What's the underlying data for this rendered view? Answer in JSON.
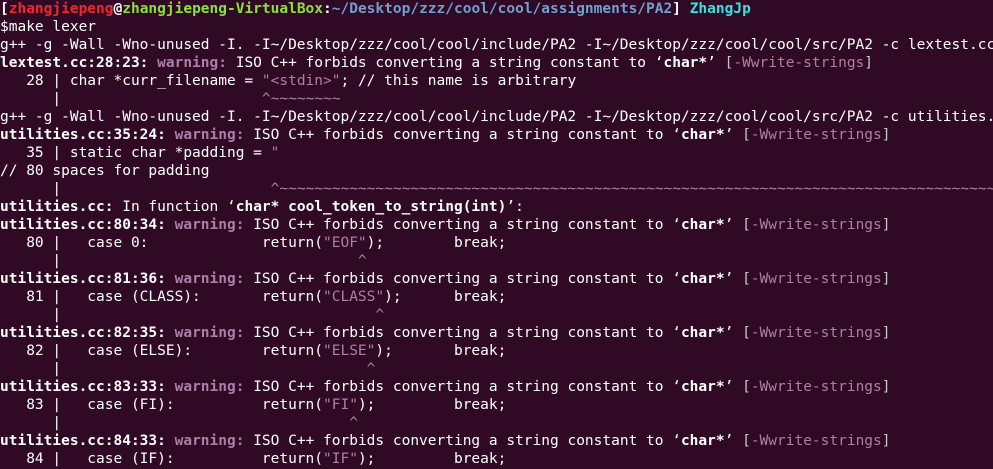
{
  "prompt": {
    "bracket_open": "[",
    "user": "zhangjiepeng",
    "at": "@",
    "host": "zhangjiepeng-VirtualBox",
    "colon": ":",
    "path": "~/Desktop/zzz/cool/cool/assignments/PA2",
    "bracket_close": "]",
    "name": "ZhangJp"
  },
  "lines": [
    {
      "segs": [
        {
          "t": "$make lexer"
        }
      ]
    },
    {
      "segs": [
        {
          "t": "g++ -g -Wall -Wno-unused -I. -I~/Desktop/zzz/cool/cool/include/PA2 -I~/Desktop/zzz/cool/cool/src/PA2 -c lextest.cc"
        }
      ]
    },
    {
      "segs": [
        {
          "t": "lextest.cc:28:23: ",
          "c": "bold"
        },
        {
          "t": "warning: ",
          "c": "bold warn"
        },
        {
          "t": "ISO C++ forbids converting a string constant to "
        },
        {
          "t": "‘"
        },
        {
          "t": "char*",
          "c": "bold"
        },
        {
          "t": "’ "
        },
        {
          "t": "[",
          "c": "gray"
        },
        {
          "t": "-Wwrite-strings",
          "c": "warn"
        },
        {
          "t": "]",
          "c": "gray"
        }
      ]
    },
    {
      "segs": [
        {
          "t": "   28 | char *curr_filename = "
        },
        {
          "t": "\"<stdin>\"",
          "c": "warn"
        },
        {
          "t": "; // this name is arbitrary"
        }
      ]
    },
    {
      "segs": [
        {
          "t": "      |                       "
        },
        {
          "t": "^~~~~~~~~",
          "c": "warn"
        }
      ]
    },
    {
      "segs": [
        {
          "t": "g++ -g -Wall -Wno-unused -I. -I~/Desktop/zzz/cool/cool/include/PA2 -I~/Desktop/zzz/cool/cool/src/PA2 -c utilities.cc"
        }
      ]
    },
    {
      "segs": [
        {
          "t": "utilities.cc:35:24: ",
          "c": "bold"
        },
        {
          "t": "warning: ",
          "c": "bold warn"
        },
        {
          "t": "ISO C++ forbids converting a string constant to "
        },
        {
          "t": "‘"
        },
        {
          "t": "char*",
          "c": "bold"
        },
        {
          "t": "’ "
        },
        {
          "t": "[",
          "c": "gray"
        },
        {
          "t": "-Wwrite-strings",
          "c": "warn"
        },
        {
          "t": "]",
          "c": "gray"
        }
      ]
    },
    {
      "segs": [
        {
          "t": "   35 | static char *padding = "
        },
        {
          "t": "\"",
          "c": "warn"
        }
      ]
    },
    {
      "segs": [
        {
          "t": "// 80 spaces for padding"
        }
      ]
    },
    {
      "segs": [
        {
          "t": "      |                        "
        },
        {
          "t": "^~~~~~~~~~~~~~~~~~~~~~~~~~~~~~~~~~~~~~~~~~~~~~~~~~~~~~~~~~~~~~~~~~~~~~~~~~~~~~~~~~~~~~~~~~~~~~~~",
          "c": "warn"
        }
      ]
    },
    {
      "segs": [
        {
          "t": "utilities.cc:",
          "c": "bold"
        },
        {
          "t": " In function "
        },
        {
          "t": "‘"
        },
        {
          "t": "char* cool_token_to_string(int)",
          "c": "bold"
        },
        {
          "t": "’:"
        }
      ]
    },
    {
      "segs": [
        {
          "t": "utilities.cc:80:34: ",
          "c": "bold"
        },
        {
          "t": "warning: ",
          "c": "bold warn"
        },
        {
          "t": "ISO C++ forbids converting a string constant to "
        },
        {
          "t": "‘"
        },
        {
          "t": "char*",
          "c": "bold"
        },
        {
          "t": "’ "
        },
        {
          "t": "[",
          "c": "gray"
        },
        {
          "t": "-Wwrite-strings",
          "c": "warn"
        },
        {
          "t": "]",
          "c": "gray"
        }
      ]
    },
    {
      "segs": [
        {
          "t": "   80 |   case 0:             return("
        },
        {
          "t": "\"EOF\"",
          "c": "warn"
        },
        {
          "t": ");        break;"
        }
      ]
    },
    {
      "segs": [
        {
          "t": "      |                                  "
        },
        {
          "t": "^",
          "c": "warn"
        }
      ]
    },
    {
      "segs": [
        {
          "t": "utilities.cc:81:36: ",
          "c": "bold"
        },
        {
          "t": "warning: ",
          "c": "bold warn"
        },
        {
          "t": "ISO C++ forbids converting a string constant to "
        },
        {
          "t": "‘"
        },
        {
          "t": "char*",
          "c": "bold"
        },
        {
          "t": "’ "
        },
        {
          "t": "[",
          "c": "gray"
        },
        {
          "t": "-Wwrite-strings",
          "c": "warn"
        },
        {
          "t": "]",
          "c": "gray"
        }
      ]
    },
    {
      "segs": [
        {
          "t": "   81 |   case (CLASS):       return("
        },
        {
          "t": "\"CLASS\"",
          "c": "warn"
        },
        {
          "t": ");      break;"
        }
      ]
    },
    {
      "segs": [
        {
          "t": "      |                                    "
        },
        {
          "t": "^",
          "c": "warn"
        }
      ]
    },
    {
      "segs": [
        {
          "t": "utilities.cc:82:35: ",
          "c": "bold"
        },
        {
          "t": "warning: ",
          "c": "bold warn"
        },
        {
          "t": "ISO C++ forbids converting a string constant to "
        },
        {
          "t": "‘"
        },
        {
          "t": "char*",
          "c": "bold"
        },
        {
          "t": "’ "
        },
        {
          "t": "[",
          "c": "gray"
        },
        {
          "t": "-Wwrite-strings",
          "c": "warn"
        },
        {
          "t": "]",
          "c": "gray"
        }
      ]
    },
    {
      "segs": [
        {
          "t": "   82 |   case (ELSE):        return("
        },
        {
          "t": "\"ELSE\"",
          "c": "warn"
        },
        {
          "t": ");       break;"
        }
      ]
    },
    {
      "segs": [
        {
          "t": "      |                                   "
        },
        {
          "t": "^",
          "c": "warn"
        }
      ]
    },
    {
      "segs": [
        {
          "t": "utilities.cc:83:33: ",
          "c": "bold"
        },
        {
          "t": "warning: ",
          "c": "bold warn"
        },
        {
          "t": "ISO C++ forbids converting a string constant to "
        },
        {
          "t": "‘"
        },
        {
          "t": "char*",
          "c": "bold"
        },
        {
          "t": "’ "
        },
        {
          "t": "[",
          "c": "gray"
        },
        {
          "t": "-Wwrite-strings",
          "c": "warn"
        },
        {
          "t": "]",
          "c": "gray"
        }
      ]
    },
    {
      "segs": [
        {
          "t": "   83 |   case (FI):          return("
        },
        {
          "t": "\"FI\"",
          "c": "warn"
        },
        {
          "t": ");         break;"
        }
      ]
    },
    {
      "segs": [
        {
          "t": "      |                                 "
        },
        {
          "t": "^",
          "c": "warn"
        }
      ]
    },
    {
      "segs": [
        {
          "t": "utilities.cc:84:33: ",
          "c": "bold"
        },
        {
          "t": "warning: ",
          "c": "bold warn"
        },
        {
          "t": "ISO C++ forbids converting a string constant to "
        },
        {
          "t": "‘"
        },
        {
          "t": "char*",
          "c": "bold"
        },
        {
          "t": "’ "
        },
        {
          "t": "[",
          "c": "gray"
        },
        {
          "t": "-Wwrite-strings",
          "c": "warn"
        },
        {
          "t": "]",
          "c": "gray"
        }
      ]
    },
    {
      "segs": [
        {
          "t": "   84 |   case (IF):          return("
        },
        {
          "t": "\"IF\"",
          "c": "warn"
        },
        {
          "t": ");         break;"
        }
      ]
    }
  ],
  "colors": {
    "background": "#300a24",
    "foreground": "#ffffff",
    "user_red": "#ef2929",
    "host_green": "#8ae234",
    "path_blue": "#729fcf",
    "name_cyan": "#34e2e2",
    "warning_magenta": "#ad7fa8"
  }
}
